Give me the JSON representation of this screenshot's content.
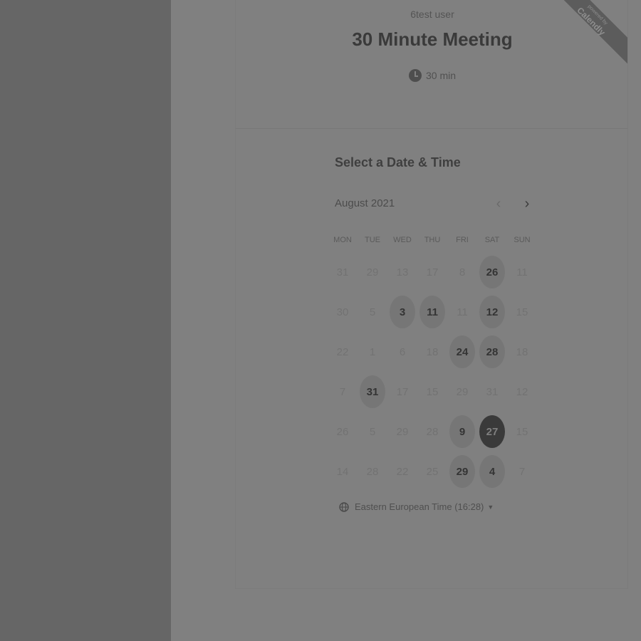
{
  "organizer": "6test user",
  "event": {
    "title": "30 Minute Meeting",
    "duration": "30 min"
  },
  "ribbon": {
    "small": "powered by",
    "brand": "Calendly"
  },
  "picker": {
    "title": "Select a Date & Time",
    "month": "August 2021",
    "prev_icon": "chevron-left-icon",
    "next_icon": "chevron-right-icon",
    "weekdays": [
      "MON",
      "TUE",
      "WED",
      "THU",
      "FRI",
      "SAT",
      "SUN"
    ],
    "weeks": [
      [
        {
          "d": "31",
          "s": "u"
        },
        {
          "d": "29",
          "s": "u"
        },
        {
          "d": "13",
          "s": "u"
        },
        {
          "d": "17",
          "s": "u"
        },
        {
          "d": "8",
          "s": "u"
        },
        {
          "d": "26",
          "s": "a"
        },
        {
          "d": "11",
          "s": "u"
        }
      ],
      [
        {
          "d": "30",
          "s": "u"
        },
        {
          "d": "5",
          "s": "u"
        },
        {
          "d": "3",
          "s": "a"
        },
        {
          "d": "11",
          "s": "a"
        },
        {
          "d": "11",
          "s": "u"
        },
        {
          "d": "12",
          "s": "a"
        },
        {
          "d": "15",
          "s": "u"
        }
      ],
      [
        {
          "d": "22",
          "s": "u"
        },
        {
          "d": "1",
          "s": "u"
        },
        {
          "d": "6",
          "s": "u"
        },
        {
          "d": "18",
          "s": "u"
        },
        {
          "d": "24",
          "s": "a"
        },
        {
          "d": "28",
          "s": "a"
        },
        {
          "d": "18",
          "s": "u"
        }
      ],
      [
        {
          "d": "7",
          "s": "u"
        },
        {
          "d": "31",
          "s": "a"
        },
        {
          "d": "17",
          "s": "u"
        },
        {
          "d": "15",
          "s": "u"
        },
        {
          "d": "29",
          "s": "u"
        },
        {
          "d": "31",
          "s": "u"
        },
        {
          "d": "12",
          "s": "u"
        }
      ],
      [
        {
          "d": "26",
          "s": "u"
        },
        {
          "d": "5",
          "s": "u"
        },
        {
          "d": "29",
          "s": "u"
        },
        {
          "d": "28",
          "s": "u"
        },
        {
          "d": "9",
          "s": "a"
        },
        {
          "d": "27",
          "s": "sel"
        },
        {
          "d": "15",
          "s": "u"
        }
      ],
      [
        {
          "d": "14",
          "s": "u"
        },
        {
          "d": "28",
          "s": "u"
        },
        {
          "d": "22",
          "s": "u"
        },
        {
          "d": "25",
          "s": "u"
        },
        {
          "d": "29",
          "s": "a"
        },
        {
          "d": "4",
          "s": "a"
        },
        {
          "d": "7",
          "s": "u"
        }
      ]
    ],
    "timezone": "Eastern European Time (16:28)",
    "timezone_icon": "globe-icon"
  },
  "colors": {
    "accent": "#3a3a3a",
    "available_bg": "#767676",
    "overlay": "#808080"
  }
}
